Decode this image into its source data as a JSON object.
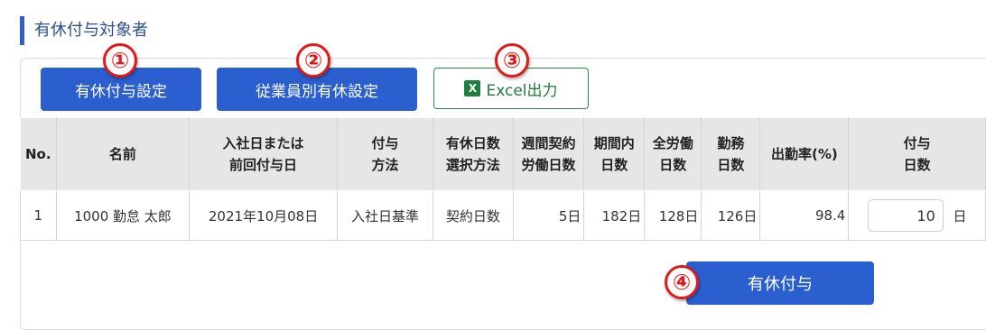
{
  "section_title": "有休付与対象者",
  "toolbar": {
    "annual_leave_settings_label": "有休付与設定",
    "employee_leave_settings_label": "従業員別有休設定",
    "excel_export_label": "Excel出力",
    "excel_icon_glyph": "X"
  },
  "markers": [
    "①",
    "②",
    "③",
    "④"
  ],
  "table": {
    "headers": [
      "No.",
      "名前",
      "入社日または\n前回付与日",
      "付与\n方法",
      "有休日数\n選択方法",
      "週間契約\n労働日数",
      "期間内\n日数",
      "全労働\n日数",
      "勤務\n日数",
      "出勤率(%)",
      "付与\n日数"
    ],
    "rows": [
      {
        "no": "1",
        "name": "1000 勤怠 太郎",
        "date": "2021年10月08日",
        "method": "入社日基準",
        "selection": "契約日数",
        "weekly_days": "5日",
        "period_days": "182日",
        "total_work_days": "128日",
        "attended_days": "126日",
        "attendance_rate": "98.4",
        "grant_days": "10",
        "grant_unit": "日"
      }
    ]
  },
  "grant_button_label": "有休付与",
  "colors": {
    "accent": "#2b5fcf",
    "marker": "#e01919",
    "excel": "#1e7e3e"
  }
}
